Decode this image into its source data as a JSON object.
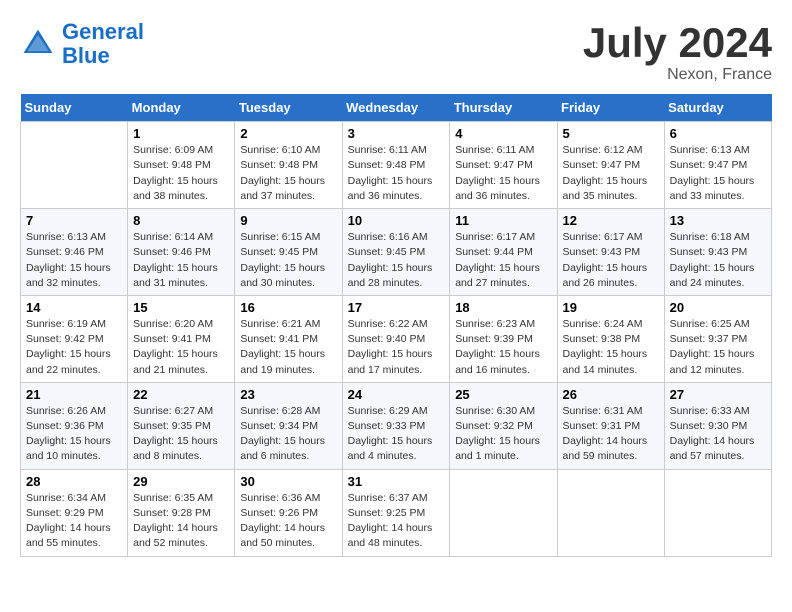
{
  "header": {
    "logo_line1": "General",
    "logo_line2": "Blue",
    "main_title": "July 2024",
    "subtitle": "Nexon, France"
  },
  "columns": [
    "Sunday",
    "Monday",
    "Tuesday",
    "Wednesday",
    "Thursday",
    "Friday",
    "Saturday"
  ],
  "weeks": [
    [
      {
        "day": "",
        "info": ""
      },
      {
        "day": "1",
        "info": "Sunrise: 6:09 AM\nSunset: 9:48 PM\nDaylight: 15 hours\nand 38 minutes."
      },
      {
        "day": "2",
        "info": "Sunrise: 6:10 AM\nSunset: 9:48 PM\nDaylight: 15 hours\nand 37 minutes."
      },
      {
        "day": "3",
        "info": "Sunrise: 6:11 AM\nSunset: 9:48 PM\nDaylight: 15 hours\nand 36 minutes."
      },
      {
        "day": "4",
        "info": "Sunrise: 6:11 AM\nSunset: 9:47 PM\nDaylight: 15 hours\nand 36 minutes."
      },
      {
        "day": "5",
        "info": "Sunrise: 6:12 AM\nSunset: 9:47 PM\nDaylight: 15 hours\nand 35 minutes."
      },
      {
        "day": "6",
        "info": "Sunrise: 6:13 AM\nSunset: 9:47 PM\nDaylight: 15 hours\nand 33 minutes."
      }
    ],
    [
      {
        "day": "7",
        "info": "Sunrise: 6:13 AM\nSunset: 9:46 PM\nDaylight: 15 hours\nand 32 minutes."
      },
      {
        "day": "8",
        "info": "Sunrise: 6:14 AM\nSunset: 9:46 PM\nDaylight: 15 hours\nand 31 minutes."
      },
      {
        "day": "9",
        "info": "Sunrise: 6:15 AM\nSunset: 9:45 PM\nDaylight: 15 hours\nand 30 minutes."
      },
      {
        "day": "10",
        "info": "Sunrise: 6:16 AM\nSunset: 9:45 PM\nDaylight: 15 hours\nand 28 minutes."
      },
      {
        "day": "11",
        "info": "Sunrise: 6:17 AM\nSunset: 9:44 PM\nDaylight: 15 hours\nand 27 minutes."
      },
      {
        "day": "12",
        "info": "Sunrise: 6:17 AM\nSunset: 9:43 PM\nDaylight: 15 hours\nand 26 minutes."
      },
      {
        "day": "13",
        "info": "Sunrise: 6:18 AM\nSunset: 9:43 PM\nDaylight: 15 hours\nand 24 minutes."
      }
    ],
    [
      {
        "day": "14",
        "info": "Sunrise: 6:19 AM\nSunset: 9:42 PM\nDaylight: 15 hours\nand 22 minutes."
      },
      {
        "day": "15",
        "info": "Sunrise: 6:20 AM\nSunset: 9:41 PM\nDaylight: 15 hours\nand 21 minutes."
      },
      {
        "day": "16",
        "info": "Sunrise: 6:21 AM\nSunset: 9:41 PM\nDaylight: 15 hours\nand 19 minutes."
      },
      {
        "day": "17",
        "info": "Sunrise: 6:22 AM\nSunset: 9:40 PM\nDaylight: 15 hours\nand 17 minutes."
      },
      {
        "day": "18",
        "info": "Sunrise: 6:23 AM\nSunset: 9:39 PM\nDaylight: 15 hours\nand 16 minutes."
      },
      {
        "day": "19",
        "info": "Sunrise: 6:24 AM\nSunset: 9:38 PM\nDaylight: 15 hours\nand 14 minutes."
      },
      {
        "day": "20",
        "info": "Sunrise: 6:25 AM\nSunset: 9:37 PM\nDaylight: 15 hours\nand 12 minutes."
      }
    ],
    [
      {
        "day": "21",
        "info": "Sunrise: 6:26 AM\nSunset: 9:36 PM\nDaylight: 15 hours\nand 10 minutes."
      },
      {
        "day": "22",
        "info": "Sunrise: 6:27 AM\nSunset: 9:35 PM\nDaylight: 15 hours\nand 8 minutes."
      },
      {
        "day": "23",
        "info": "Sunrise: 6:28 AM\nSunset: 9:34 PM\nDaylight: 15 hours\nand 6 minutes."
      },
      {
        "day": "24",
        "info": "Sunrise: 6:29 AM\nSunset: 9:33 PM\nDaylight: 15 hours\nand 4 minutes."
      },
      {
        "day": "25",
        "info": "Sunrise: 6:30 AM\nSunset: 9:32 PM\nDaylight: 15 hours\nand 1 minute."
      },
      {
        "day": "26",
        "info": "Sunrise: 6:31 AM\nSunset: 9:31 PM\nDaylight: 14 hours\nand 59 minutes."
      },
      {
        "day": "27",
        "info": "Sunrise: 6:33 AM\nSunset: 9:30 PM\nDaylight: 14 hours\nand 57 minutes."
      }
    ],
    [
      {
        "day": "28",
        "info": "Sunrise: 6:34 AM\nSunset: 9:29 PM\nDaylight: 14 hours\nand 55 minutes."
      },
      {
        "day": "29",
        "info": "Sunrise: 6:35 AM\nSunset: 9:28 PM\nDaylight: 14 hours\nand 52 minutes."
      },
      {
        "day": "30",
        "info": "Sunrise: 6:36 AM\nSunset: 9:26 PM\nDaylight: 14 hours\nand 50 minutes."
      },
      {
        "day": "31",
        "info": "Sunrise: 6:37 AM\nSunset: 9:25 PM\nDaylight: 14 hours\nand 48 minutes."
      },
      {
        "day": "",
        "info": ""
      },
      {
        "day": "",
        "info": ""
      },
      {
        "day": "",
        "info": ""
      }
    ]
  ]
}
